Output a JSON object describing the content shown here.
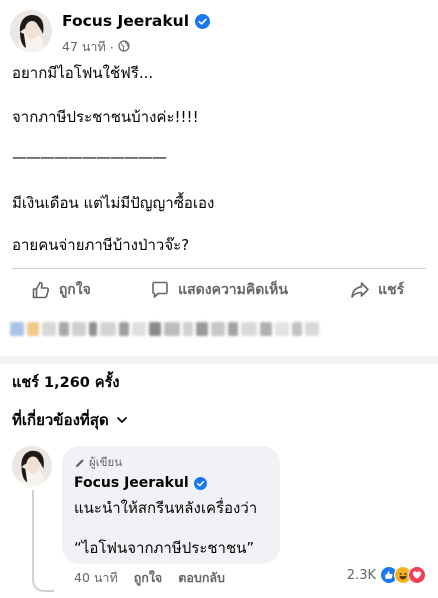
{
  "post": {
    "author": "Focus Jeerakul",
    "time": "47 นาที",
    "separator": "·",
    "lines": [
      "อยากมีไอโฟนใช้ฟรี...",
      "จากภาษีประชาชนบ้างค่ะ!!!!",
      "———————————",
      "มีเงินเดือน แต่ไม่มีปัญญาซื้อเอง",
      "อายคนจ่ายภาษีบ้างป่าวจ๊ะ?"
    ],
    "actions": {
      "like": "ถูกใจ",
      "comment": "แสดงความคิดเห็น",
      "share": "แชร์"
    }
  },
  "shares": "แชร์ 1,260 ครั้ง",
  "filter": "ที่เกี่ยวข้องที่สุด",
  "comment": {
    "author_tag": "ผู้เขียน",
    "author": "Focus Jeerakul",
    "lines": [
      "แนะนำให้สกรีนหลังเครื่องว่า",
      "“ไอโฟนจากภาษีประชาชน”"
    ],
    "time": "40 นาที",
    "like": "ถูกใจ",
    "reply": "ตอบกลับ",
    "reaction_count": "2.3K"
  },
  "colors": {
    "brand_blue": "#1877f2",
    "secondary_text": "#65676b",
    "bubble_bg": "#f0f2f5",
    "haha_yellow": "#f7b125",
    "love_red": "#f33e58"
  }
}
